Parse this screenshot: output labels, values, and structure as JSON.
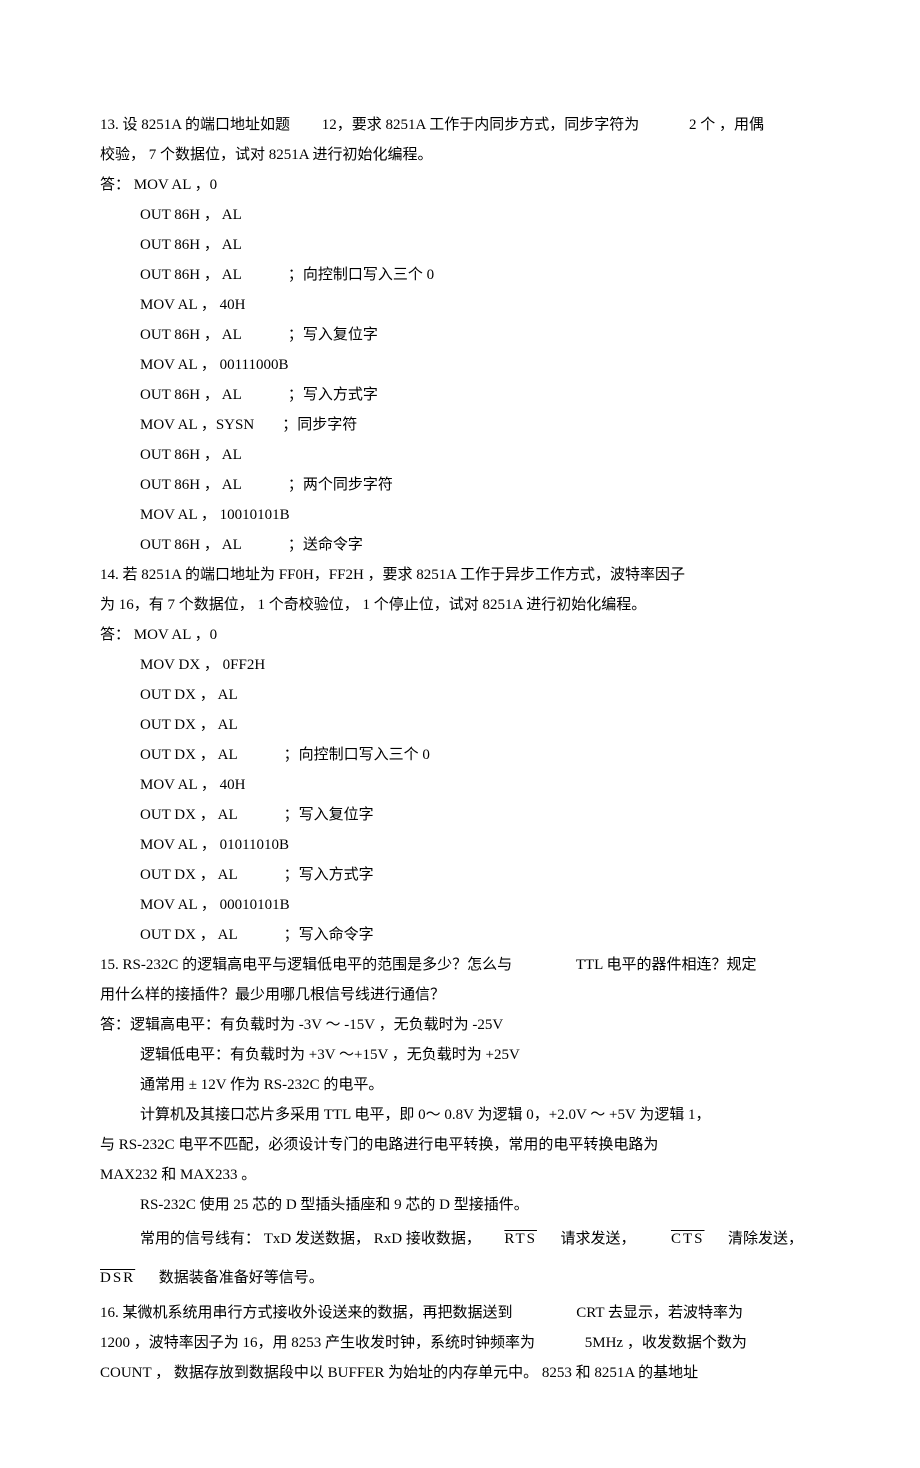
{
  "q13": {
    "text_a": "13. 设 8251A 的端口地址如题",
    "text_b": "12，要求  8251A 工作于内同步方式，同步字符为",
    "text_c": "2 个 ，用偶",
    "text_d": "校验，  7 个数据位，试对   8251A 进行初始化编程。",
    "ans_label": "答： MOV  AL   ，0",
    "code": [
      {
        "t": "OUT 86H  ， AL"
      },
      {
        "t": "OUT 86H  ， AL"
      },
      {
        "t": "OUT 86H  ， AL",
        "c": "；向控制口写入三个    0"
      },
      {
        "t": "MOV  AL   ， 40H"
      },
      {
        "t": "OUT 86H  ， AL",
        "c": "；写入复位字"
      },
      {
        "t": "MOV  AL   ， 00111000B"
      },
      {
        "t": "OUT 86H  ， AL",
        "c": "；写入方式字"
      },
      {
        "t": "MOV  AL   ，SYSN",
        "c": "；同步字符"
      },
      {
        "t": "OUT 86H  ， AL"
      },
      {
        "t": "OUT 86H  ， AL",
        "c": "；两个同步字符"
      },
      {
        "t": "MOV  AL   ， 10010101B"
      },
      {
        "t": "OUT 86H  ， AL",
        "c": "；送命令字"
      }
    ]
  },
  "q14": {
    "text_a": "14. 若  8251A 的端口地址为    FF0H，FF2H ，要求   8251A 工作于异步工作方式，波特率因子",
    "text_b": "为 16，有 7 个数据位，   1 个奇校验位，   1 个停止位，试对    8251A 进行初始化编程。",
    "ans_label": "答： MOV  AL   ，0",
    "code": [
      {
        "t": "MOV DX   ， 0FF2H"
      },
      {
        "t": "OUT  DX  ， AL"
      },
      {
        "t": "OUT  DX  ， AL"
      },
      {
        "t": "OUT  DX  ， AL",
        "c": "；向控制口写入三个    0"
      },
      {
        "t": "MOV  AL   ， 40H"
      },
      {
        "t": "OUT  DX  ， AL",
        "c": "；写入复位字"
      },
      {
        "t": "MOV  AL   ， 01011010B"
      },
      {
        "t": "OUT  DX  ， AL",
        "c": "；写入方式字"
      },
      {
        "t": "MOV  AL   ， 00010101B"
      },
      {
        "t": "OUT  DX  ， AL",
        "c": "；写入命令字"
      }
    ]
  },
  "q15": {
    "text_a": "15. RS-232C 的逻辑高电平与逻辑低电平的范围是多少？怎么与",
    "text_b": "TTL 电平的器件相连？规定",
    "text_c": "用什么样的接插件？最少用哪几根信号线进行通信？",
    "ans_lines": [
      "答：逻辑高电平：有负载时为      -3V ～ -15V ，无负载时为  -25V",
      "逻辑低电平：有负载时为    +3V ～+15V ，无负载时为  +25V",
      "通常用 ± 12V  作为  RS-232C 的电平。",
      "计算机及其接口芯片多采用      TTL  电平，即   0～ 0.8V 为逻辑  0，+2.0V ～ +5V 为逻辑  1，"
    ],
    "cont1": "与  RS-232C  电平不匹配，必须设计专门的电路进行电平转换，常用的电平转换电路为",
    "cont2": "MAX232   和 MAX233 。",
    "cont3": "RS-232C 使用  25 芯的  D  型插头插座和    9 芯的  D  型接插件。",
    "sig_a": "常用的信号线有：    TxD  发送数据，  RxD   接收数据，",
    "sig_rts": "RTS",
    "sig_b": "请求发送，",
    "sig_cts": "CTS",
    "sig_c": "清除发送，",
    "sig_dsr": "DSR",
    "sig_d": "数据装备准备好等信号。"
  },
  "q16": {
    "line1_a": "16.  某微机系统用串行方式接收外设送来的数据，再把数据送到",
    "line1_b": "CRT 去显示，若波特率为",
    "line2_a": "1200 ，波特率因子为    16，用 8253 产生收发时钟，系统时钟频率为",
    "line2_b": "5MHz ，收发数据个数为",
    "line3_a": "COUNT ， 数据存放到数据段中以     BUFFER  为始址的内存单元中。   8253 和 8251A 的基地址"
  }
}
